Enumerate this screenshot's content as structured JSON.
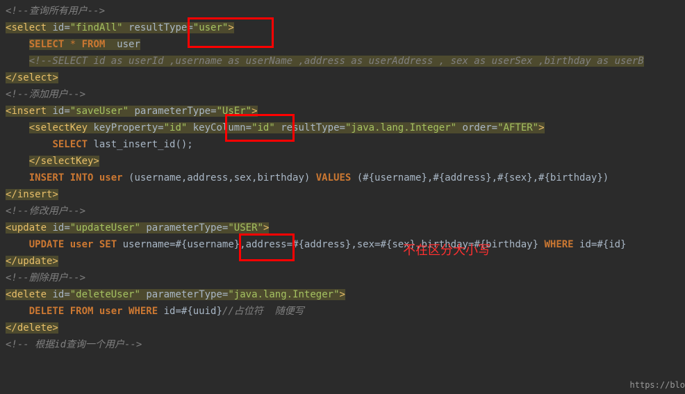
{
  "lines": {
    "c1": "<!--查询所有用户-->",
    "l2_open": "<",
    "l2_tag": "select",
    "l2_attr1": " id",
    "l2_eq": "=",
    "l2_val1": "\"findAll\"",
    "l2_attr2": " resultType",
    "l2_val2": "\"user\"",
    "l2_close": ">",
    "l3_kw": "SELECT",
    "l3_star": " * ",
    "l3_from": "FROM",
    "l3_tbl": "  user",
    "l4": "<!--SELECT id as userId ,username as userName ,address as userAddress , sex as userSex ,birthday as userB",
    "l5": "</select>",
    "c2": "<!--添加用户-->",
    "l7_tag": "insert",
    "l7_val1": "\"saveUser\"",
    "l7_attr2": " parameterType",
    "l7_val2": "\"UsEr\"",
    "l8_tag": "selectKey",
    "l8_a1": " keyProperty",
    "l8_v1": "\"id\"",
    "l8_a2": " keyColumn",
    "l8_v2": "\"id\"",
    "l8_a3": " resultType",
    "l8_v3": "\"java.lang.Integer\"",
    "l8_a4": " order",
    "l8_v4": "\"AFTER\"",
    "l9_kw": "SELECT",
    "l9_fn": " last_insert_id();",
    "l10": "</selectKey>",
    "l11_kw1": "INSERT INTO",
    "l11_tbl": " user ",
    "l11_cols": "(username,address,sex,birthday) ",
    "l11_kw2": "VALUES",
    "l11_vals": " (#{username},#{address},#{sex},#{birthday})",
    "l12": "</insert>",
    "c3": "<!--修改用户-->",
    "l14_tag": "update",
    "l14_val1": "\"updateUser\"",
    "l14_val2": "\"USER\"",
    "l15_kw1": "UPDATE",
    "l15_tbl": " user ",
    "l15_kw2": "SET",
    "l15_body": " username=#{username},address=#{address},sex=#{sex},birthday=#{birthday} ",
    "l15_kw3": "WHERE",
    "l15_cond": " id=#{id}",
    "l16": "</update>",
    "c4": "<!--删除用户-->",
    "l18_tag": "delete",
    "l18_val1": "\"deleteUser\"",
    "l18_val2": "\"java.lang.Integer\"",
    "l19_kw": "DELETE FROM",
    "l19_tbl": " user ",
    "l19_kw2": "WHERE",
    "l19_body": " id=#{uuid}",
    "l19_comment": "//占位符  随便写",
    "l20": "</delete>",
    "c5": "<!-- 根据id查询一个用户-->"
  },
  "annotation": "不在区分大小写",
  "watermark": "https://blo"
}
